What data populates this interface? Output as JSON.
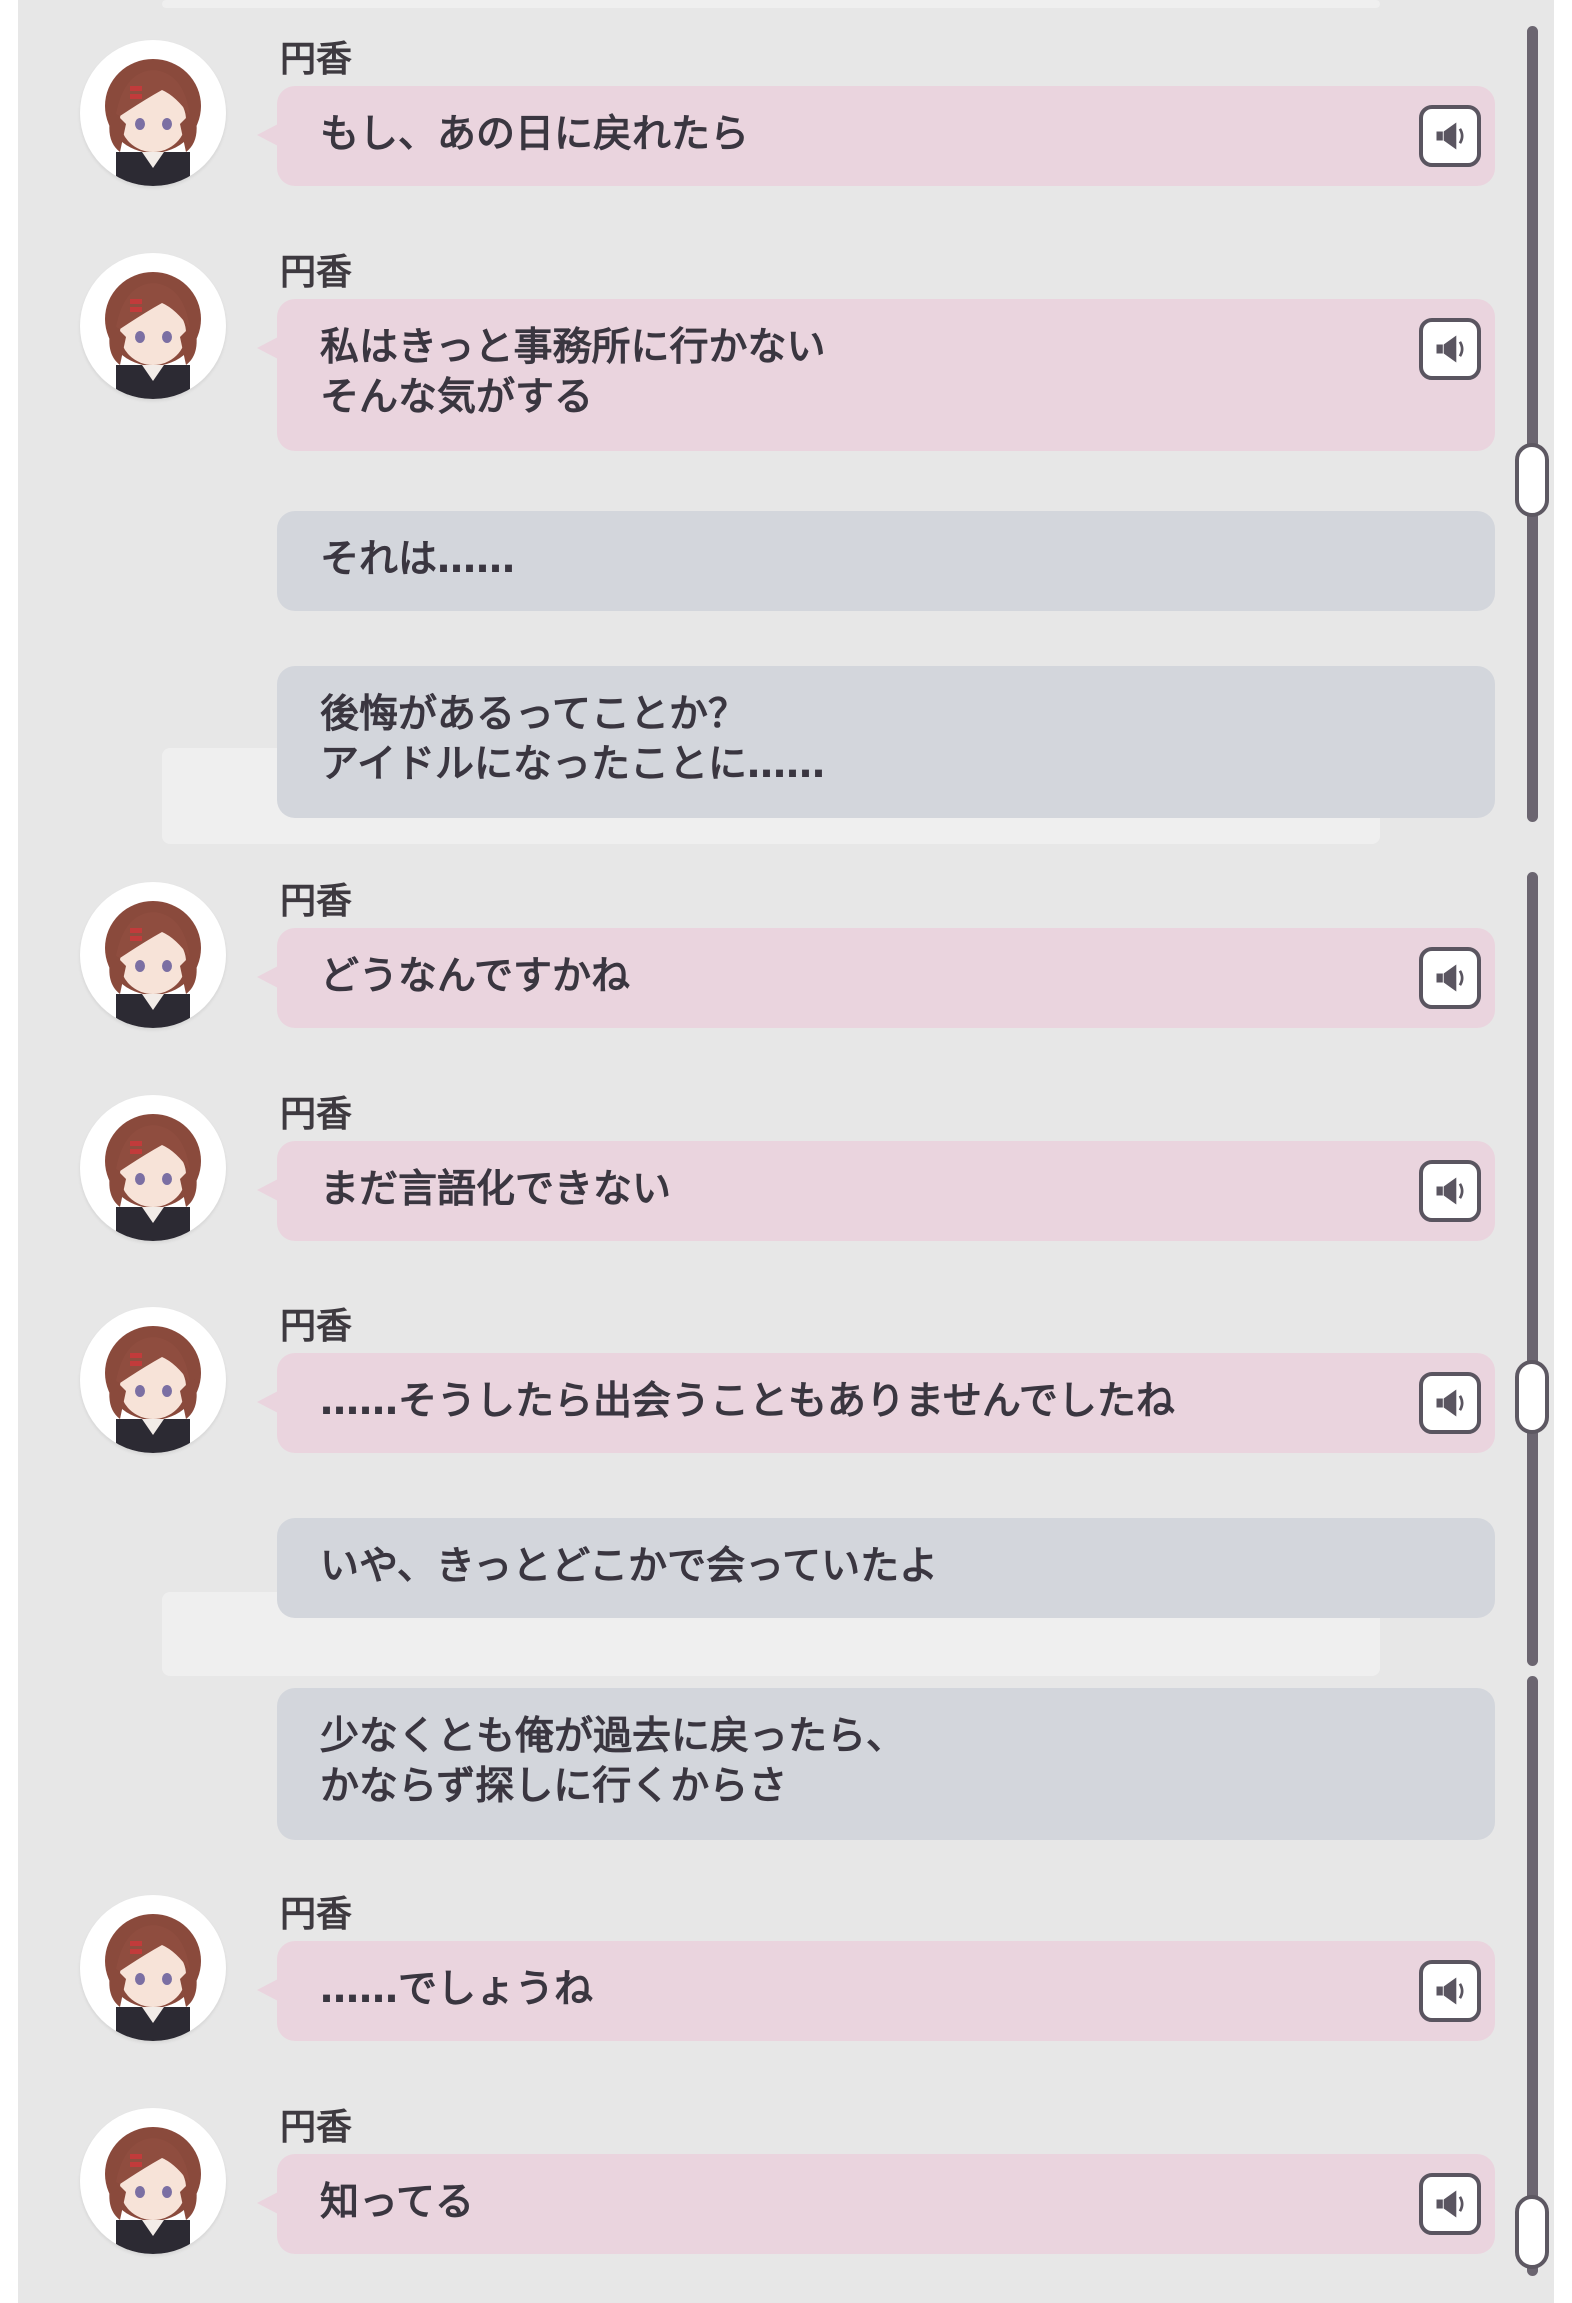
{
  "log": {
    "voice_icon": "speaker-icon",
    "colors": {
      "character_bubble": "#ead4de",
      "producer_bubble": "#d3d6dc",
      "background": "#e7e7e7",
      "text": "#3a3640"
    },
    "entries": [
      {
        "type": "character",
        "speaker": "円香",
        "lines": [
          "もし、あの日に戻れたら"
        ]
      },
      {
        "type": "character",
        "speaker": "円香",
        "lines": [
          "私はきっと事務所に行かない",
          "そんな気がする"
        ]
      },
      {
        "type": "producer",
        "lines": [
          "それは……"
        ]
      },
      {
        "type": "producer",
        "lines": [
          "後悔があるってことか？",
          "アイドルになったことに……"
        ]
      },
      {
        "type": "character",
        "speaker": "円香",
        "lines": [
          "どうなんですかね"
        ]
      },
      {
        "type": "character",
        "speaker": "円香",
        "lines": [
          "まだ言語化できない"
        ]
      },
      {
        "type": "character",
        "speaker": "円香",
        "lines": [
          "……そうしたら出会うこともありませんでしたね"
        ]
      },
      {
        "type": "producer",
        "lines": [
          "いや、きっとどこかで会っていたよ"
        ]
      },
      {
        "type": "producer",
        "lines": [
          "少なくとも俺が過去に戻ったら、",
          "かならず探しに行くからさ"
        ]
      },
      {
        "type": "character",
        "speaker": "円香",
        "lines": [
          "……でしょうね"
        ]
      },
      {
        "type": "character",
        "speaker": "円香",
        "lines": [
          "知ってる"
        ]
      }
    ]
  }
}
